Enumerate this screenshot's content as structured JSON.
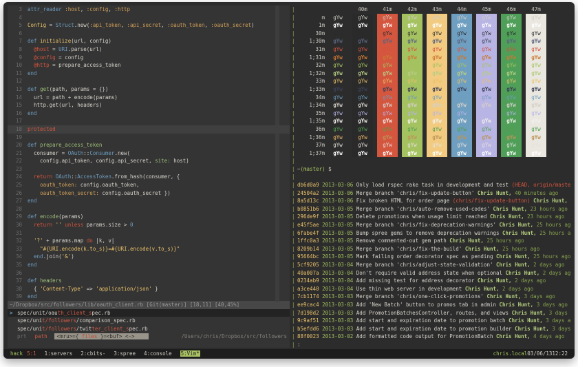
{
  "colors": {
    "terminal_bg": "#2c2c2c",
    "vim_bg": "#343434",
    "statusbar_bg": "#1d1d1d",
    "pane_divider": "#99a05a",
    "cursorline": "#3f3f3f",
    "accent_green": "#a5c261",
    "accent_red": "#d2543e",
    "accent_yellow": "#e8c06a",
    "accent_blue": "#6d9cbe"
  },
  "vim": {
    "lines": [
      {
        "n": "3",
        "s": [
          [
            "attr_reader",
            "b"
          ],
          [
            " ",
            "w"
          ],
          [
            ":host",
            "s"
          ],
          [
            ", ",
            "w"
          ],
          [
            ":config",
            "s"
          ],
          [
            ", ",
            "w"
          ],
          [
            ":http",
            "s"
          ]
        ]
      },
      {
        "n": "4",
        "s": []
      },
      {
        "n": "5",
        "s": [
          [
            "Config",
            "y"
          ],
          [
            " = ",
            "w"
          ],
          [
            "Struct",
            "b"
          ],
          [
            ".new(",
            "w"
          ],
          [
            ":api_token",
            "s"
          ],
          [
            ", ",
            "w"
          ],
          [
            ":api_secret",
            "s"
          ],
          [
            ", ",
            "w"
          ],
          [
            ":oauth_token",
            "s"
          ],
          [
            ", ",
            "w"
          ],
          [
            ":oauth_secret",
            "s"
          ],
          [
            ")",
            "w"
          ]
        ]
      },
      {
        "n": "6",
        "s": []
      },
      {
        "n": "7",
        "s": [
          [
            "def",
            "b"
          ],
          [
            " ",
            "w"
          ],
          [
            "initialize",
            "y"
          ],
          [
            "(url, config)",
            "w"
          ]
        ]
      },
      {
        "n": "8",
        "s": [
          [
            "  ",
            "w"
          ],
          [
            "@host",
            "r"
          ],
          [
            " = ",
            "w"
          ],
          [
            "URI",
            "b"
          ],
          [
            ".parse(url)",
            "w"
          ]
        ]
      },
      {
        "n": "9",
        "s": [
          [
            "  ",
            "w"
          ],
          [
            "@config",
            "r"
          ],
          [
            " = config",
            "w"
          ]
        ]
      },
      {
        "n": "10",
        "s": [
          [
            "  ",
            "w"
          ],
          [
            "@http",
            "r"
          ],
          [
            " = prepare_access_token",
            "w"
          ]
        ]
      },
      {
        "n": "11",
        "s": [
          [
            "end",
            "b"
          ]
        ]
      },
      {
        "n": "12",
        "s": []
      },
      {
        "n": "13",
        "s": [
          [
            "def",
            "b"
          ],
          [
            " ",
            "w"
          ],
          [
            "get",
            "g"
          ],
          [
            "(path, params = {})",
            "w"
          ]
        ]
      },
      {
        "n": "14",
        "s": [
          [
            "  url = path + encode(params)",
            "w"
          ]
        ]
      },
      {
        "n": "15",
        "s": [
          [
            "  http.get(url, headers)",
            "w"
          ]
        ]
      },
      {
        "n": "16",
        "s": [
          [
            "end",
            "b"
          ]
        ]
      },
      {
        "n": "17",
        "s": []
      },
      {
        "n": "18",
        "cur": true,
        "s": [
          [
            "protected",
            "r"
          ]
        ]
      },
      {
        "n": "19",
        "s": []
      },
      {
        "n": "20",
        "s": [
          [
            "def",
            "b"
          ],
          [
            " ",
            "w"
          ],
          [
            "prepare_access_token",
            "g"
          ]
        ]
      },
      {
        "n": "21",
        "s": [
          [
            "  consumer = ",
            "w"
          ],
          [
            "OAuth",
            "b"
          ],
          [
            "::",
            "w"
          ],
          [
            "Consumer",
            "b"
          ],
          [
            ".new(",
            "w"
          ]
        ]
      },
      {
        "n": "22",
        "s": [
          [
            "    config.api_token, config.api_secret, ",
            "w"
          ],
          [
            "site:",
            "g"
          ],
          [
            " host)",
            "w"
          ]
        ]
      },
      {
        "n": "23",
        "s": []
      },
      {
        "n": "24",
        "s": [
          [
            "  ",
            "w"
          ],
          [
            "return",
            "r"
          ],
          [
            " ",
            "w"
          ],
          [
            "OAuth",
            "b"
          ],
          [
            "::",
            "w"
          ],
          [
            "AccessToken",
            "b"
          ],
          [
            ".from_hash(consumer, {",
            "w"
          ]
        ]
      },
      {
        "n": "25",
        "s": [
          [
            "    ",
            "w"
          ],
          [
            "oauth_token:",
            "s"
          ],
          [
            " config.oauth_token,",
            "w"
          ]
        ]
      },
      {
        "n": "26",
        "s": [
          [
            "    ",
            "w"
          ],
          [
            "oauth_token_secret:",
            "s"
          ],
          [
            " config.oauth_secret })",
            "w"
          ]
        ]
      },
      {
        "n": "27",
        "s": [
          [
            "end",
            "b"
          ]
        ]
      },
      {
        "n": "28",
        "s": []
      },
      {
        "n": "29",
        "s": [
          [
            "def",
            "b"
          ],
          [
            " ",
            "w"
          ],
          [
            "encode",
            "g"
          ],
          [
            "(params)",
            "w"
          ]
        ]
      },
      {
        "n": "30",
        "s": [
          [
            "  ",
            "w"
          ],
          [
            "return",
            "r"
          ],
          [
            " ",
            "w"
          ],
          [
            "''",
            "y"
          ],
          [
            " ",
            "w"
          ],
          [
            "unless",
            "r"
          ],
          [
            " params.size > ",
            "w"
          ],
          [
            "0",
            "b"
          ]
        ]
      },
      {
        "n": "31",
        "s": []
      },
      {
        "n": "32",
        "s": [
          [
            "  ",
            "w"
          ],
          [
            "'?'",
            "y"
          ],
          [
            " + params.map ",
            "w"
          ],
          [
            "do",
            "r"
          ],
          [
            " |k, v|",
            "w"
          ]
        ]
      },
      {
        "n": "33",
        "s": [
          [
            "    ",
            "w"
          ],
          [
            "\"#{URI.encode(k.to_s)}=#{URI.encode(v.to_s)}\"",
            "y"
          ]
        ]
      },
      {
        "n": "34",
        "s": [
          [
            "  ",
            "w"
          ],
          [
            "end",
            "b"
          ],
          [
            ".join(",
            "w"
          ],
          [
            "'&'",
            "y"
          ],
          [
            ")",
            "w"
          ]
        ]
      },
      {
        "n": "35",
        "s": [
          [
            "end",
            "b"
          ]
        ]
      },
      {
        "n": "36",
        "s": []
      },
      {
        "n": "37",
        "s": [
          [
            "def",
            "b"
          ],
          [
            " ",
            "w"
          ],
          [
            "headers",
            "g"
          ]
        ]
      },
      {
        "n": "38",
        "s": [
          [
            "  { ",
            "w"
          ],
          [
            "'Content-Type'",
            "y"
          ],
          [
            " => ",
            "w"
          ],
          [
            "'application/json'",
            "y"
          ],
          [
            " }",
            "w"
          ]
        ]
      },
      {
        "n": "39",
        "s": [
          [
            "end",
            "b"
          ]
        ]
      }
    ],
    "statusline": "~/Dropbox/src/followers/lib/oauth_client.rb [Git(master)] [18,11] [40,45%]",
    "ctrlp": {
      "results": [
        {
          "selected": true,
          "marker": ">",
          "s": [
            [
              "spec/unit/oau",
              "w"
            ],
            [
              "th_client_s",
              "m"
            ],
            [
              "pec.rb",
              "w"
            ]
          ]
        },
        {
          "selected": false,
          "s": [
            [
              "spec/uni",
              "w"
            ],
            [
              "t/followers",
              "m"
            ],
            [
              "/comparison_spec.rb",
              "w"
            ]
          ]
        },
        {
          "selected": false,
          "s": [
            [
              "spec/uni",
              "w"
            ],
            [
              "t/followers",
              "m"
            ],
            [
              "/twit",
              "w"
            ],
            [
              "ter_client_s",
              "m"
            ],
            [
              "pec.rb",
              "w"
            ]
          ]
        }
      ],
      "prompt": {
        "prt": "prt",
        "mode": "path",
        "box_pre": "<mru>={ ",
        "box_mode": "files",
        "box_post": " }=<buf> <->",
        "dir": "/Users/chris/Dropbox/src/followers"
      }
    }
  },
  "color_table": {
    "headers": [
      "40m",
      "41m",
      "42m",
      "43m",
      "44m",
      "45m",
      "46m",
      "47m"
    ],
    "col_bg": [
      "#2a2a2a",
      "#d4563f",
      "#a5c261",
      "#f2cb80",
      "#6f9fc0",
      "#b8b4e4",
      "#4f9f58",
      "#e9e7df"
    ],
    "cell_text": "gYw",
    "rows": [
      {
        "label": "m",
        "fg": "#cfccc4",
        "bold": false
      },
      {
        "label": "1m",
        "fg": "#ffffff",
        "bold": true
      },
      {
        "label": "30m",
        "fg": "#2b2b2b",
        "bold": false
      },
      {
        "label": "1;30m",
        "fg": "#5a647e",
        "bold": true
      },
      {
        "label": "31m",
        "fg": "#d2543e",
        "bold": false
      },
      {
        "label": "1;31m",
        "fg": "#cc7833",
        "bold": true
      },
      {
        "label": "32m",
        "fg": "#a5c261",
        "bold": false
      },
      {
        "label": "1;32m",
        "fg": "#b7cc85",
        "bold": true
      },
      {
        "label": "33m",
        "fg": "#e8c06a",
        "bold": false
      },
      {
        "label": "1;33m",
        "fg": "#3a4055",
        "bold": true
      },
      {
        "label": "34m",
        "fg": "#6d9cbe",
        "bold": false
      },
      {
        "label": "1;34m",
        "fg": "#d4cfc9",
        "bold": true
      },
      {
        "label": "35m",
        "fg": "#b6b3eb",
        "bold": false
      },
      {
        "label": "1;35m",
        "fg": "#f4f1ed",
        "bold": true
      },
      {
        "label": "36m",
        "fg": "#519f50",
        "bold": false
      },
      {
        "label": "1;36m",
        "fg": "#bc9458",
        "bold": true
      },
      {
        "label": "37m",
        "fg": "#e6e1dc",
        "bold": false
      },
      {
        "label": "1;37m",
        "fg": "#ffffff",
        "bold": true
      }
    ]
  },
  "shell": {
    "dir": "~",
    "branch": "(master)",
    "prompt": " $",
    "pager": ":"
  },
  "git_log": [
    {
      "hash": "db6d0a9",
      "date": "2013-03-06",
      "msg": "Only load rspec rake task in development and test ",
      "ref": "(HEAD, origin/maste",
      "author": "",
      "time": ""
    },
    {
      "hash": "24504a2",
      "date": "2013-03-06",
      "msg": "Merge branch 'chris/fix-update-button' ",
      "ref": "",
      "author": "Chris Hunt,",
      "time": " 40 minutes ago"
    },
    {
      "hash": "8a5d13c",
      "date": "2013-03-06",
      "msg": "Fix broken HTML for order page ",
      "ref": "(chris/fix-update-button)",
      "author": " Chris Hunt,",
      "time": ""
    },
    {
      "hash": "b0851b6",
      "date": "2013-03-05",
      "msg": "Merge branch 'chris/auto-remove-used-codes' ",
      "ref": "",
      "author": "Chris Hunt,",
      "time": " 23 hours ago"
    },
    {
      "hash": "296de9f",
      "date": "2013-03-05",
      "msg": "Delete promotions when usage limit reached ",
      "ref": "",
      "author": "Chris Hunt,",
      "time": " 23 hours ago"
    },
    {
      "hash": "e45f5ae",
      "date": "2013-03-05",
      "msg": "Merge branch 'chris/fix-deprecation-warnings' ",
      "ref": "",
      "author": "Chris Hunt,",
      "time": " 25 hours ag"
    },
    {
      "hash": "6fabe4f",
      "date": "2013-03-05",
      "msg": "Bump spree gems to remove deprecation warnings ",
      "ref": "",
      "author": "Chris Hunt,",
      "time": " 25 hours a"
    },
    {
      "hash": "1ffc0a3",
      "date": "2013-03-05",
      "msg": "Remove commented-out gem path ",
      "ref": "",
      "author": "Chris Hunt,",
      "time": " 25 hours ago"
    },
    {
      "hash": "8209b14",
      "date": "2013-03-05",
      "msg": "Merge branch 'chris/fix-the-build' ",
      "ref": "",
      "author": "Chris Hunt,",
      "time": " 25 hours ago"
    },
    {
      "hash": "95664bc",
      "date": "2013-03-05",
      "msg": "Mark failing order decorator spec as pending ",
      "ref": "",
      "author": "Chris Hunt,",
      "time": " 25 hours ago"
    },
    {
      "hash": "5cf9205",
      "date": "2013-03-04",
      "msg": "Merge branch 'chris/adjust-state-validation' ",
      "ref": "",
      "author": "Chris Hunt,",
      "time": " 2 days ago"
    },
    {
      "hash": "40a007a",
      "date": "2013-03-04",
      "msg": "Don't require valid address state when optional ",
      "ref": "",
      "author": "Chris Hunt,",
      "time": " 2 days ag"
    },
    {
      "hash": "0234ab9",
      "date": "2013-03-04",
      "msg": "Add missing test for address decorator ",
      "ref": "",
      "author": "Chris Hunt,",
      "time": " 2 days ago"
    },
    {
      "hash": "a3ce440",
      "date": "2013-03-04",
      "msg": "Use thin web server in development ",
      "ref": "",
      "author": "Chris Hunt,",
      "time": " 2 days ago"
    },
    {
      "hash": "7cb1174",
      "date": "2013-03-03",
      "msg": "Merge branch 'chris/one-click-promotions' ",
      "ref": "",
      "author": "Chris Hunt,",
      "time": " 3 days ago"
    },
    {
      "hash": "ee9cac4",
      "date": "2013-03-03",
      "msg": "Add 'New Batch' button to promos tab in admin ",
      "ref": "",
      "author": "Chris Hunt,",
      "time": " 3 days ago"
    },
    {
      "hash": "7d198d2",
      "date": "2013-03-03",
      "msg": "Add PromotionBatchesController, routes, and views ",
      "ref": "",
      "author": "Chris Hunt,",
      "time": " 3 days"
    },
    {
      "hash": "9c9af51",
      "date": "2013-03-03",
      "msg": "Add start and expiration date to promotion batch ",
      "ref": "",
      "author": "Chris Hunt,",
      "time": " 3 days a"
    },
    {
      "hash": "b5efdd6",
      "date": "2013-03-03",
      "msg": "Add start and expiration date to promotion builder ",
      "ref": "",
      "author": "Chris Hunt,",
      "time": " 3 days"
    },
    {
      "hash": "88f0023",
      "date": "2013-03-02",
      "msg": "Add formatted code output for PromotionBatch ",
      "ref": "",
      "author": "Chris Hunt,",
      "time": " 4 days ago"
    }
  ],
  "tmux": {
    "session": "hack",
    "pane": "5:1",
    "windows": [
      {
        "label": "1:servers",
        "active": false
      },
      {
        "label": "2:cbits-",
        "active": false
      },
      {
        "label": "3:spree",
        "active": false
      },
      {
        "label": "4:console",
        "active": false
      },
      {
        "label": "5:Vim*",
        "active": true
      }
    ],
    "host": "chris.local",
    "date": "03/06/13",
    "time": "12:22"
  }
}
